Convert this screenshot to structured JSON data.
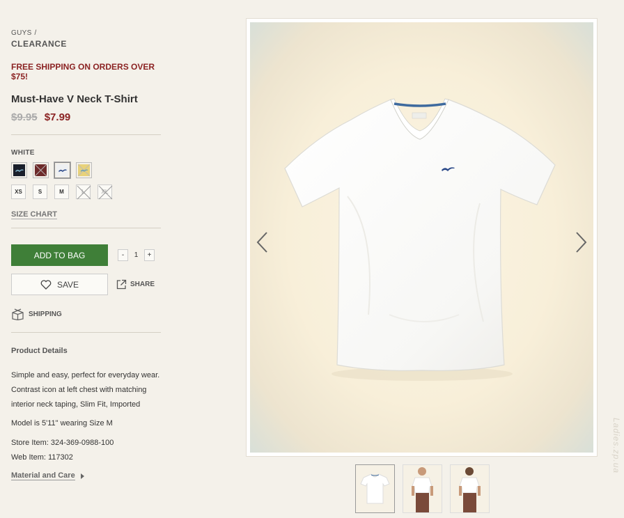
{
  "breadcrumb": {
    "parent": "GUYS",
    "separator": "/",
    "current": "CLEARANCE"
  },
  "promo": "FREE SHIPPING ON ORDERS OVER $75!",
  "product": {
    "title": "Must-Have V Neck T-Shirt",
    "original_price": "$9.95",
    "sale_price": "$7.99",
    "selected_color": "WHITE"
  },
  "swatches": [
    {
      "name": "navy",
      "color": "#1a1f2b"
    },
    {
      "name": "burgundy",
      "color": "#6d2a2a"
    },
    {
      "name": "white",
      "color": "#eef0f2"
    },
    {
      "name": "yellow",
      "color": "#e8d27a"
    }
  ],
  "sizes": [
    {
      "label": "XS",
      "available": true
    },
    {
      "label": "S",
      "available": true
    },
    {
      "label": "M",
      "available": true
    },
    {
      "label": "L",
      "available": false
    },
    {
      "label": "XL",
      "available": false
    }
  ],
  "size_chart_label": "SIZE CHART",
  "cart": {
    "add_label": "ADD TO BAG",
    "minus": "-",
    "quantity": "1",
    "plus": "+"
  },
  "save_label": "SAVE",
  "share_label": "SHARE",
  "shipping_label": "SHIPPING",
  "details": {
    "title": "Product Details",
    "description_lines": [
      "Simple and easy, perfect for everyday wear.",
      "Contrast icon at left chest with matching",
      "interior neck taping, Slim Fit, Imported"
    ],
    "model": "Model is 5'11\" wearing Size M",
    "store_item": "Store Item: 324-369-0988-100",
    "web_item": "Web Item: 117302"
  },
  "material_label": "Material and Care",
  "watermark": "Ladies.zp.ua",
  "colors": {
    "accent_green": "#3f7f38",
    "sale_red": "#8b2323",
    "background": "#f4f1ea"
  }
}
